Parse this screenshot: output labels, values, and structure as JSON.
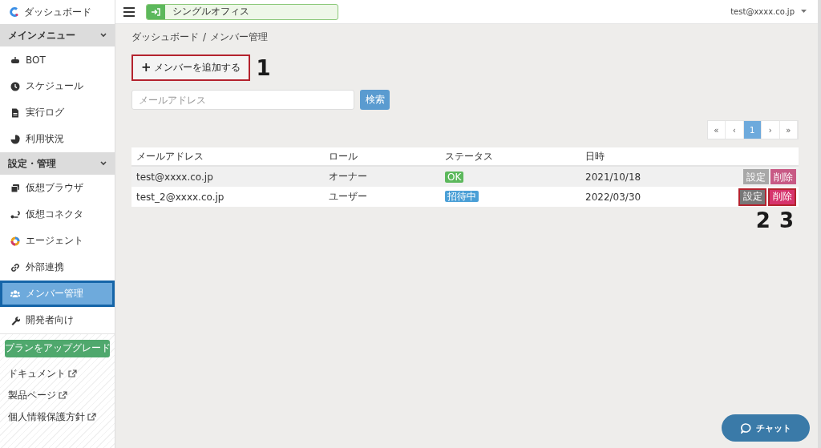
{
  "sidebar": {
    "logo": "ダッシュボード",
    "sections": [
      {
        "title": "メインメニュー",
        "expanded": true,
        "items": [
          {
            "label": "BOT",
            "selected": false
          },
          {
            "label": "スケジュール",
            "selected": false
          },
          {
            "label": "実行ログ",
            "selected": false
          },
          {
            "label": "利用状況",
            "selected": false
          }
        ]
      },
      {
        "title": "設定・管理",
        "expanded": true,
        "items": [
          {
            "label": "仮想ブラウザ",
            "selected": false
          },
          {
            "label": "仮想コネクタ",
            "selected": false
          },
          {
            "label": "エージェント",
            "selected": false
          },
          {
            "label": "外部連携",
            "selected": false
          },
          {
            "label": "メンバー管理",
            "selected": true
          },
          {
            "label": "開発者向け",
            "selected": false
          }
        ]
      }
    ],
    "upgrade_button": "プランをアップグレード",
    "links": [
      "ドキュメント",
      "製品ページ",
      "個人情報保護方針"
    ]
  },
  "topbar": {
    "workspace": "シングルオフィス",
    "user": "test@xxxx.co.jp"
  },
  "breadcrumb": [
    "ダッシュボード",
    "メンバー管理"
  ],
  "breadcrumb_separator": "/",
  "add_button": {
    "icon": "+",
    "label": "メンバーを追加する",
    "highlighted": true,
    "annotation": "1"
  },
  "search": {
    "placeholder": "メールアドレス",
    "button": "検索"
  },
  "pagination": [
    {
      "label": "«",
      "selected": false
    },
    {
      "label": "‹",
      "selected": false
    },
    {
      "label": "1",
      "selected": true
    },
    {
      "label": "›",
      "selected": false
    },
    {
      "label": "»",
      "selected": false
    }
  ],
  "table": {
    "columns": [
      "メールアドレス",
      "ロール",
      "ステータス",
      "日時"
    ],
    "rows": [
      {
        "email": "test@xxxx.co.jp",
        "role": "オーナー",
        "status": {
          "text": "OK",
          "kind": "ok"
        },
        "date": "2021/10/18",
        "actions": [
          {
            "label": "設定",
            "kind": "edit",
            "disabled": true,
            "highlighted": false
          },
          {
            "label": "削除",
            "kind": "delete",
            "disabled": true,
            "highlighted": false
          }
        ]
      },
      {
        "email": "test_2@xxxx.co.jp",
        "role": "ユーザー",
        "status": {
          "text": "招待中",
          "kind": "invited"
        },
        "date": "2022/03/30",
        "actions": [
          {
            "label": "設定",
            "kind": "edit",
            "disabled": false,
            "highlighted": true,
            "annotation": "2"
          },
          {
            "label": "削除",
            "kind": "delete",
            "disabled": false,
            "highlighted": true,
            "annotation": "3"
          }
        ]
      }
    ]
  },
  "chat_button": "チャット"
}
